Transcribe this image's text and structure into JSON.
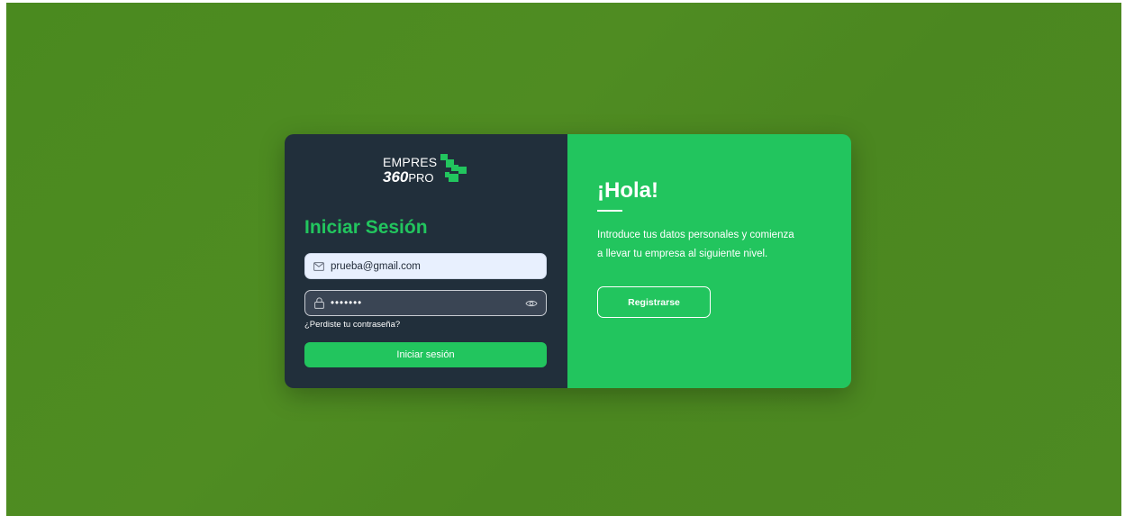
{
  "logo": {
    "top_text": "EMPRES",
    "number_text": "360",
    "suffix_text": "PRO"
  },
  "login": {
    "title": "Iniciar Sesión",
    "email_value": "prueba@gmail.com",
    "password_value": "•••••••",
    "forgot_link": "¿Perdiste tu contraseña?",
    "submit_label": "Iniciar sesión"
  },
  "welcome": {
    "heading": "¡Hola!",
    "intro_line1": "Introduce tus datos personales y comienza",
    "intro_line2": "a llevar tu empresa al siguiente nivel.",
    "register_label": "Registrarse"
  },
  "colors": {
    "background": "#4d8a22",
    "left_panel": "#212f3b",
    "accent": "#22c55e"
  },
  "icons": [
    "mail-icon",
    "lock-icon",
    "eye-icon",
    "logo-mark-icon"
  ]
}
